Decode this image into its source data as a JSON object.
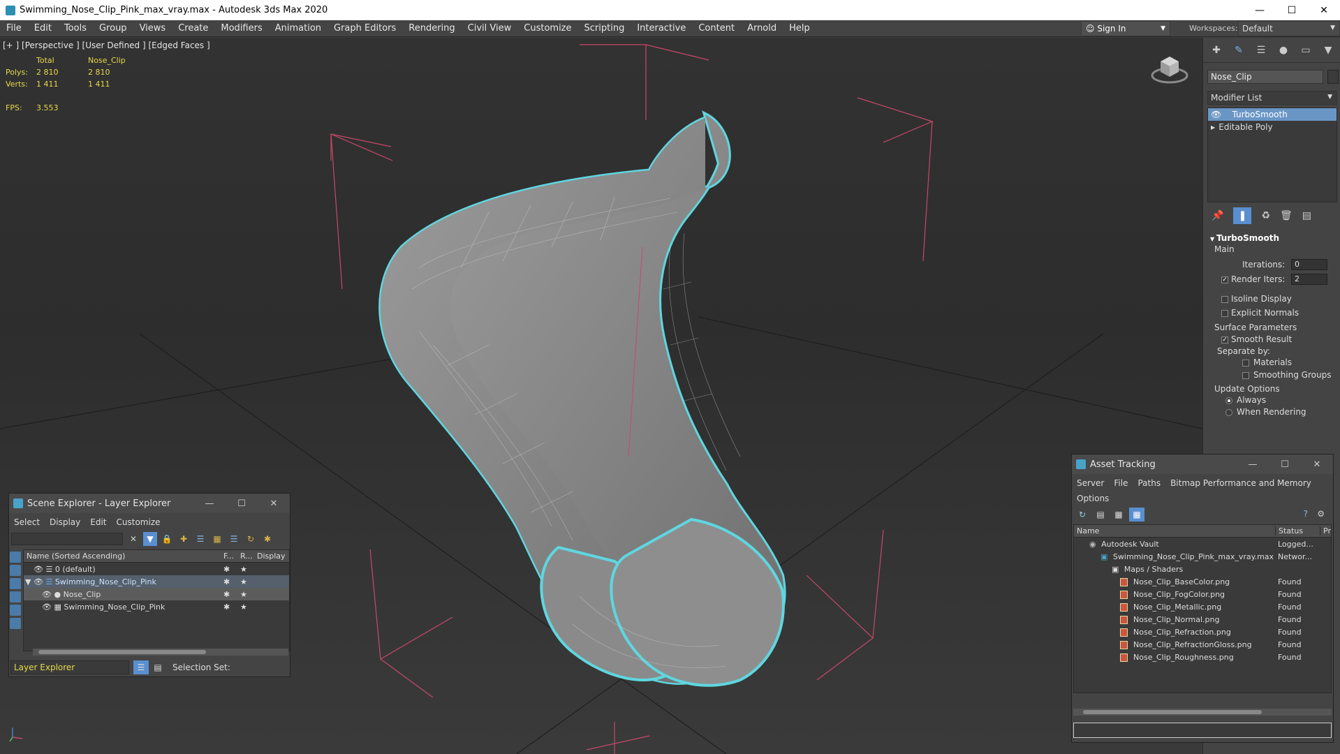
{
  "window": {
    "title": "Swimming_Nose_Clip_Pink_max_vray.max - Autodesk 3ds Max 2020"
  },
  "menu": [
    "File",
    "Edit",
    "Tools",
    "Group",
    "Views",
    "Create",
    "Modifiers",
    "Animation",
    "Graph Editors",
    "Rendering",
    "Civil View",
    "Customize",
    "Scripting",
    "Interactive",
    "Content",
    "Arnold",
    "Help"
  ],
  "account": {
    "sign_in": "Sign In",
    "workspaces_label": "Workspaces:",
    "workspace": "Default"
  },
  "viewport": {
    "label": "[+ ] [Perspective ] [User Defined ] [Edged Faces ]",
    "stats": {
      "header_total": "Total",
      "header_obj": "Nose_Clip",
      "polys_label": "Polys:",
      "polys_total": "2 810",
      "polys_obj": "2 810",
      "verts_label": "Verts:",
      "verts_total": "1 411",
      "verts_obj": "1 411",
      "fps_label": "FPS:",
      "fps_value": "3.553"
    }
  },
  "command_panel": {
    "object_name": "Nose_Clip",
    "modifier_list": "Modifier List",
    "stack": [
      "TurboSmooth",
      "Editable Poly"
    ],
    "rollout": {
      "title": "TurboSmooth",
      "main": "Main",
      "iterations_label": "Iterations:",
      "iterations": "0",
      "render_iters_label": "Render Iters:",
      "render_iters": "2",
      "isoline": "Isoline Display",
      "explicit_normals": "Explicit Normals",
      "surface_params": "Surface Parameters",
      "smooth_result": "Smooth Result",
      "separate_by": "Separate by:",
      "materials": "Materials",
      "smoothing_groups": "Smoothing Groups",
      "update_options": "Update Options",
      "always": "Always",
      "when_rendering": "When Rendering"
    }
  },
  "scene_explorer": {
    "title": "Scene Explorer - Layer Explorer",
    "menu": [
      "Select",
      "Display",
      "Edit",
      "Customize"
    ],
    "columns": {
      "name": "Name (Sorted Ascending)",
      "f": "F...",
      "r": "R...",
      "display": "Display"
    },
    "rows": [
      "0 (default)",
      "Swimming_Nose_Clip_Pink",
      "Nose_Clip",
      "Swimming_Nose_Clip_Pink"
    ],
    "footer_layer": "Layer Explorer",
    "footer_selection": "Selection Set:"
  },
  "asset_tracking": {
    "title": "Asset Tracking",
    "menu": [
      "Server",
      "File",
      "Paths",
      "Bitmap Performance and Memory"
    ],
    "menu2": "Options",
    "columns": {
      "name": "Name",
      "status": "Status",
      "pr": "Pr"
    },
    "rows": [
      {
        "name": "Autodesk Vault",
        "status": "Logged..."
      },
      {
        "name": "Swimming_Nose_Clip_Pink_max_vray.max",
        "status": "Networ..."
      },
      {
        "name": "Maps / Shaders",
        "status": ""
      },
      {
        "name": "Nose_Clip_BaseColor.png",
        "status": "Found"
      },
      {
        "name": "Nose_Clip_FogColor.png",
        "status": "Found"
      },
      {
        "name": "Nose_Clip_Metallic.png",
        "status": "Found"
      },
      {
        "name": "Nose_Clip_Normal.png",
        "status": "Found"
      },
      {
        "name": "Nose_Clip_Refraction.png",
        "status": "Found"
      },
      {
        "name": "Nose_Clip_RefractionGloss.png",
        "status": "Found"
      },
      {
        "name": "Nose_Clip_Roughness.png",
        "status": "Found"
      }
    ]
  },
  "colors": {
    "accent": "#6a96c6",
    "selection_outline": "#5fd6e0",
    "stats_text": "#e7d94a",
    "bbox": "#d94a6a"
  }
}
